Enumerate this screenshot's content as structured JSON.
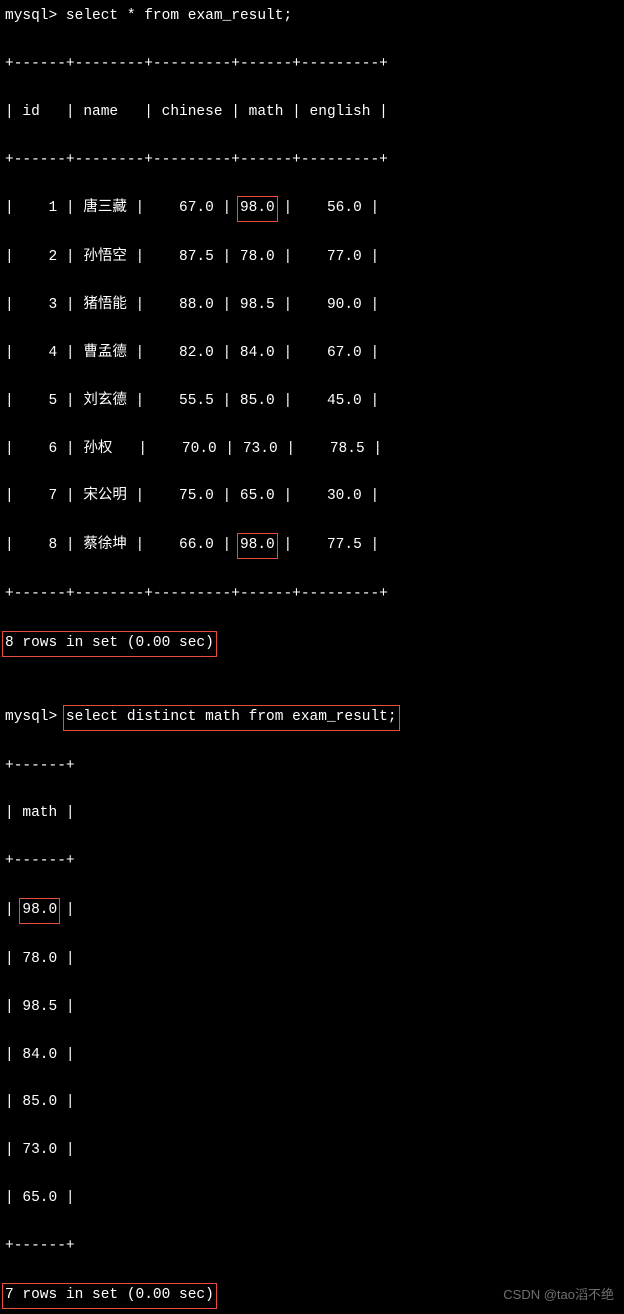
{
  "prompt1": "mysql>",
  "query1": "select * from exam_result;",
  "table1": {
    "sep_top": "+------+--------+---------+------+---------+",
    "header": "| id   | name   | chinese | math | english |",
    "sep_mid": "+------+--------+---------+------+---------+",
    "rows": [
      {
        "pre": "|    1 | 唐三藏 |    67.0 | ",
        "hl": "98.0",
        "post": " |    56.0 |"
      },
      {
        "pre": "|    2 | 孙悟空 |    87.5 | 78.0 |    77.0 |",
        "hl": "",
        "post": ""
      },
      {
        "pre": "|    3 | 猪悟能 |    88.0 | 98.5 |    90.0 |",
        "hl": "",
        "post": ""
      },
      {
        "pre": "|    4 | 曹孟德 |    82.0 | 84.0 |    67.0 |",
        "hl": "",
        "post": ""
      },
      {
        "pre": "|    5 | 刘玄德 |    55.5 | 85.0 |    45.0 |",
        "hl": "",
        "post": ""
      },
      {
        "pre": "|    6 | 孙权   |    70.0 | 73.0 |    78.5 |",
        "hl": "",
        "post": ""
      },
      {
        "pre": "|    7 | 宋公明 |    75.0 | 65.0 |    30.0 |",
        "hl": "",
        "post": ""
      },
      {
        "pre": "|    8 | 蔡徐坤 |    66.0 | ",
        "hl": "98.0",
        "post": " |    77.5 |"
      }
    ],
    "sep_bot": "+------+--------+---------+------+---------+"
  },
  "status1": "8 rows in set (0.00 sec)",
  "prompt2": "mysql>",
  "query2": "select distinct math from exam_result;",
  "table2": {
    "sep_top": "+------+",
    "header": "| math |",
    "sep_mid": "+------+",
    "rows": [
      {
        "pre": "| ",
        "hl": "98.0",
        "post": " |"
      },
      {
        "pre": "| 78.0 |",
        "hl": "",
        "post": ""
      },
      {
        "pre": "| 98.5 |",
        "hl": "",
        "post": ""
      },
      {
        "pre": "| 84.0 |",
        "hl": "",
        "post": ""
      },
      {
        "pre": "| 85.0 |",
        "hl": "",
        "post": ""
      },
      {
        "pre": "| 73.0 |",
        "hl": "",
        "post": ""
      },
      {
        "pre": "| 65.0 |",
        "hl": "",
        "post": ""
      }
    ],
    "sep_bot": "+------+"
  },
  "status2": "7 rows in set (0.00 sec)",
  "watermark": "CSDN @tao滔不绝"
}
